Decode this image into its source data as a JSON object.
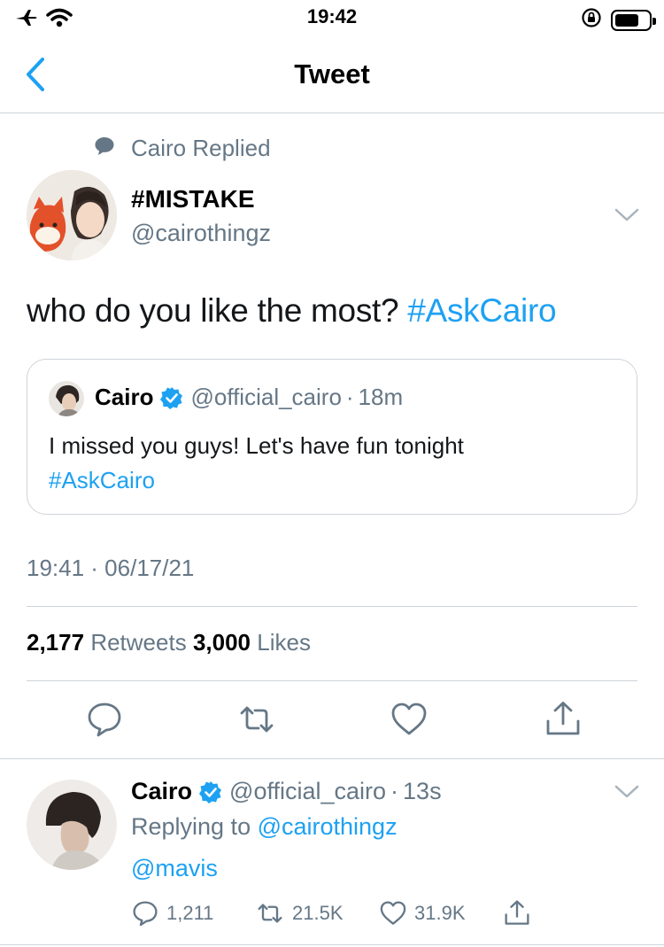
{
  "status_bar": {
    "time": "19:42"
  },
  "nav": {
    "title": "Tweet"
  },
  "tweet": {
    "social_context": "Cairo Replied",
    "author_name": "#MISTAKE",
    "author_handle": "@cairothingz",
    "text": "who do you like the most? ",
    "hashtag": "#AskCairo",
    "quoted": {
      "name": "Cairo",
      "handle": "@official_cairo",
      "separator": "·",
      "time": "18m",
      "text": "I missed you guys! Let's have fun tonight",
      "hashtag": "#AskCairo"
    },
    "timestamp": "19:41 · 06/17/21",
    "retweets_count": "2,177",
    "retweets_label": "Retweets",
    "likes_count": "3,000",
    "likes_label": "Likes"
  },
  "reply": {
    "name": "Cairo",
    "handle": "@official_cairo",
    "separator": "·",
    "time": "13s",
    "replying_prefix": "Replying to ",
    "replying_to": "@cairothingz",
    "text": "@mavis",
    "reply_count": "1,211",
    "retweet_count": "21.5K",
    "like_count": "31.9K"
  },
  "icons": {
    "airplane": "airplane-icon",
    "wifi": "wifi-icon",
    "rotation_lock": "rotation-lock-icon",
    "battery": "battery-icon",
    "back": "chevron-left-icon",
    "speech_bubble": "speech-bubble-icon",
    "verified": "verified-badge-icon",
    "more": "chevron-down-icon",
    "reply": "reply-icon",
    "retweet": "retweet-icon",
    "like": "heart-icon",
    "share": "share-icon"
  },
  "colors": {
    "accent": "#1da1f2",
    "secondary_text": "#657786",
    "divider": "#cfd4d9"
  }
}
